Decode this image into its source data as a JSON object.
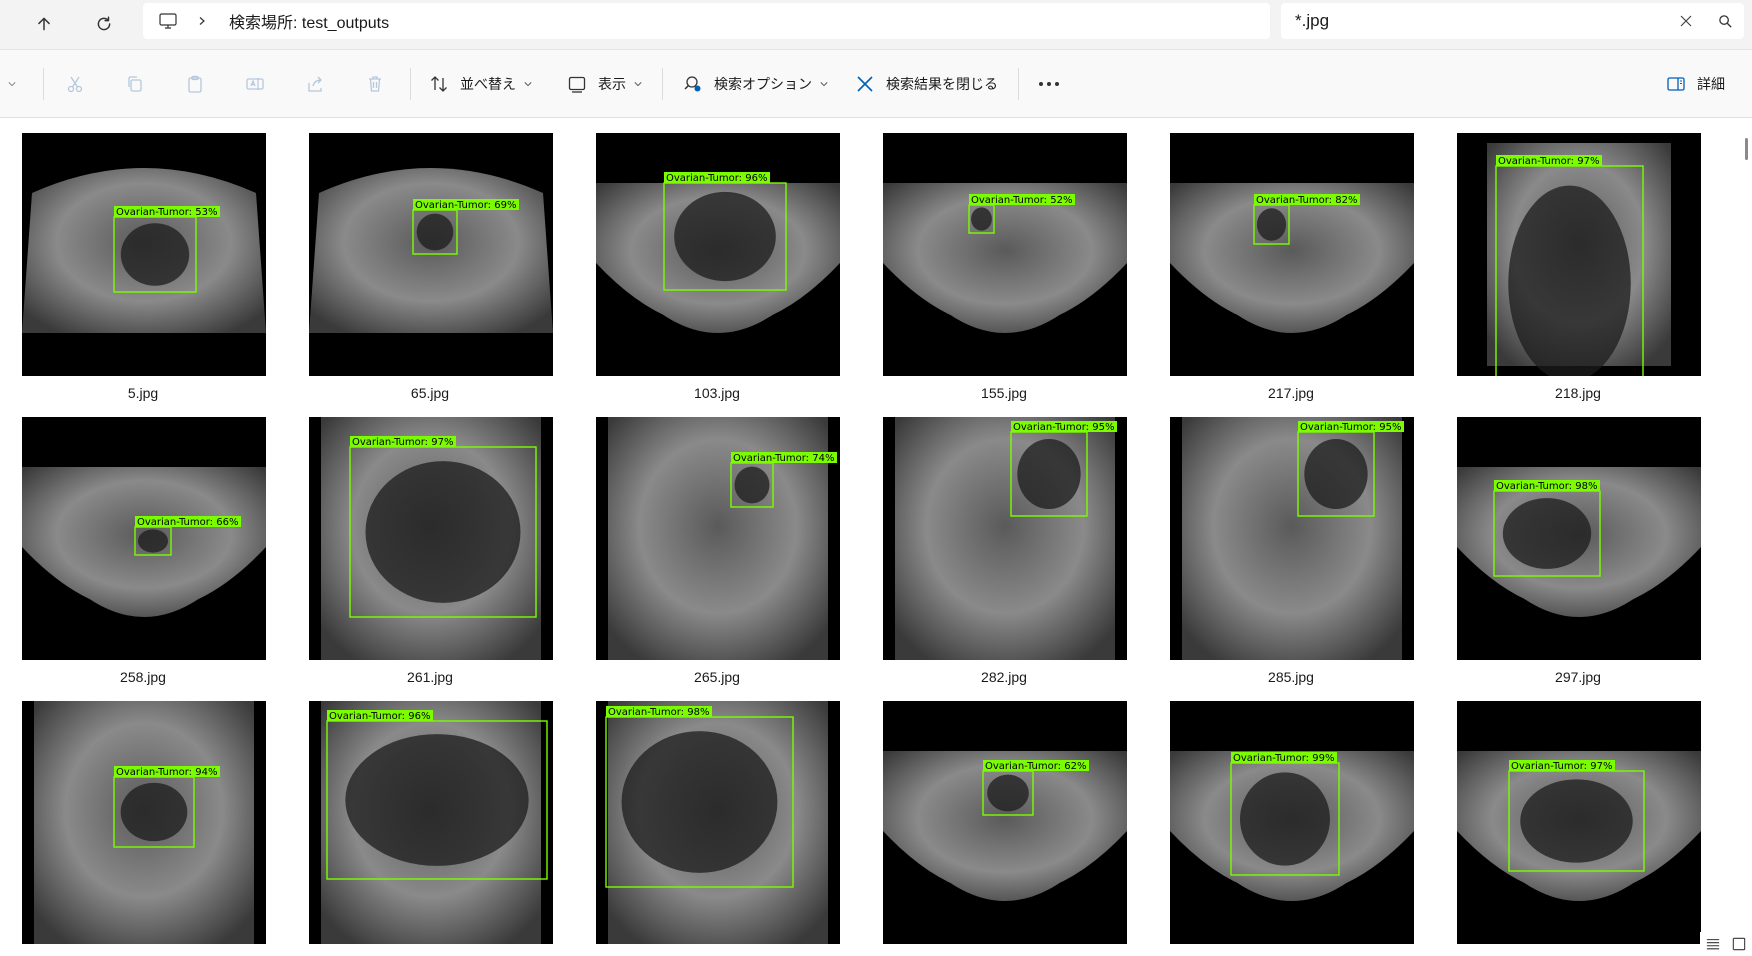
{
  "address": {
    "path_text": "検索場所: test_outputs",
    "search_query": "*.jpg"
  },
  "toolbar": {
    "sort_label": "並べ替え",
    "view_label": "表示",
    "search_options_label": "検索オプション",
    "close_search_label": "検索結果を閉じる",
    "details_label": "詳細"
  },
  "files": [
    {
      "name": "5.jpg",
      "tumor_label": "Ovarian-Tumor: 53%"
    },
    {
      "name": "65.jpg",
      "tumor_label": "Ovarian-Tumor: 69%"
    },
    {
      "name": "103.jpg",
      "tumor_label": "Ovarian-Tumor: 96%"
    },
    {
      "name": "155.jpg",
      "tumor_label": "Ovarian-Tumor: 52%"
    },
    {
      "name": "217.jpg",
      "tumor_label": "Ovarian-Tumor: 82%"
    },
    {
      "name": "218.jpg",
      "tumor_label": "Ovarian-Tumor: 97%"
    },
    {
      "name": "258.jpg",
      "tumor_label": "Ovarian-Tumor: 66%"
    },
    {
      "name": "261.jpg",
      "tumor_label": "Ovarian-Tumor: 97%"
    },
    {
      "name": "265.jpg",
      "tumor_label": "Ovarian-Tumor: 74%"
    },
    {
      "name": "282.jpg",
      "tumor_label": "Ovarian-Tumor: 95%"
    },
    {
      "name": "285.jpg",
      "tumor_label": "Ovarian-Tumor: 95%"
    },
    {
      "name": "297.jpg",
      "tumor_label": "Ovarian-Tumor: 98%"
    },
    {
      "name": "",
      "tumor_label": "Ovarian-Tumor: 94%"
    },
    {
      "name": "",
      "tumor_label": "Ovarian-Tumor: 96%"
    },
    {
      "name": "",
      "tumor_label": "Ovarian-Tumor: 98%"
    },
    {
      "name": "",
      "tumor_label": "Ovarian-Tumor: 62%"
    },
    {
      "name": "",
      "tumor_label": "Ovarian-Tumor: 99%"
    },
    {
      "name": "",
      "tumor_label": "Ovarian-Tumor: 97%"
    }
  ],
  "colors": {
    "detection_box": "#7cfc00",
    "accent": "#005fb8"
  }
}
